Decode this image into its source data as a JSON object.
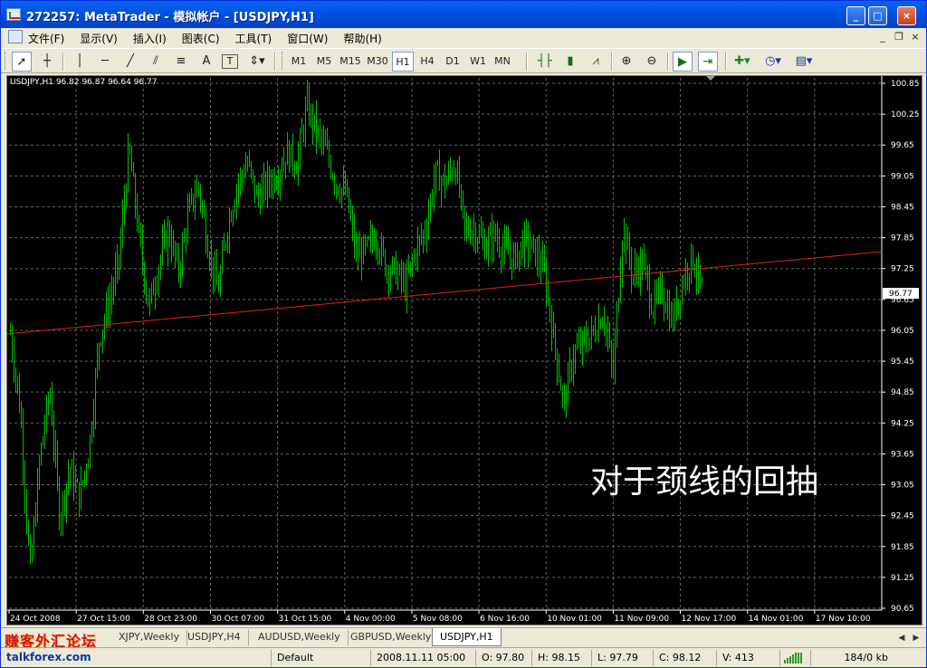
{
  "window": {
    "title": "272257: MetaTrader - 模拟帐户 - [USDJPY,H1]",
    "controls": [
      "_",
      "□",
      "×"
    ]
  },
  "menu": {
    "items": [
      "文件(F)",
      "显示(V)",
      "插入(I)",
      "图表(C)",
      "工具(T)",
      "窗口(W)",
      "帮助(H)"
    ],
    "mdi_controls": [
      "_",
      "❐",
      "×"
    ]
  },
  "toolbar": {
    "timeframes": [
      "M1",
      "M5",
      "M15",
      "M30",
      "H1",
      "H4",
      "D1",
      "W1",
      "MN"
    ],
    "active_timeframe": "H1",
    "text_tool": "A",
    "text_label_tool": "T"
  },
  "chart": {
    "symbol_info": "USDJPY,H1  96.82 96.87 96.64 96.77",
    "annotation": "对于颈线的回抽",
    "current_price_label": "96.77",
    "colors": {
      "background": "#000000",
      "bars": "#00c000",
      "grid": "#5a6a5a",
      "trendline": "#e02020",
      "text": "#ffffff"
    }
  },
  "chart_data": {
    "type": "bar",
    "title": "USDJPY,H1",
    "ylim": [
      90.65,
      100.85
    ],
    "y_ticks": [
      "100.85",
      "100.25",
      "99.65",
      "99.05",
      "98.45",
      "97.85",
      "97.25",
      "96.65",
      "96.05",
      "95.45",
      "94.85",
      "94.25",
      "93.65",
      "93.05",
      "92.45",
      "91.85",
      "91.25",
      "90.65"
    ],
    "x_ticks": [
      "24 Oct 2008",
      "27 Oct 15:00",
      "28 Oct 23:00",
      "30 Oct 07:00",
      "31 Oct 15:00",
      "4 Nov 00:00",
      "5 Nov 08:00",
      "6 Nov 16:00",
      "10 Nov 01:00",
      "11 Nov 09:00",
      "12 Nov 17:00",
      "14 Nov 01:00",
      "17 Nov 10:00"
    ],
    "price_path": [
      96.0,
      94.5,
      91.3,
      93.6,
      94.9,
      92.4,
      93.4,
      92.8,
      93.8,
      95.9,
      96.6,
      97.4,
      99.6,
      97.9,
      96.5,
      97.3,
      98.0,
      97.2,
      98.3,
      98.9,
      97.7,
      96.8,
      98.1,
      98.9,
      99.3,
      98.6,
      98.9,
      99.1,
      99.5,
      99.3,
      100.4,
      99.9,
      99.5,
      98.9,
      98.7,
      97.5,
      97.6,
      97.9,
      97.3,
      97.2,
      96.9,
      97.6,
      98.0,
      99.1,
      98.9,
      99.3,
      98.0,
      98.0,
      97.7,
      97.9,
      97.6,
      97.4,
      97.8,
      97.6,
      97.2,
      95.9,
      94.6,
      95.6,
      95.8,
      96.0,
      96.4,
      95.2,
      98.1,
      97.1,
      97.4,
      96.5,
      96.8,
      96.2,
      97.0,
      97.5,
      96.8
    ],
    "trendline": {
      "start": 95.98,
      "end": 97.58
    },
    "last_price": 96.77
  },
  "tabs": {
    "watermark": "赚客外汇论坛",
    "items": [
      "XJPY,Weekly",
      "USDJPY,H4",
      "AUDUSD,Weekly",
      "GBPUSD,Weekly",
      "USDJPY,H1"
    ],
    "active": "USDJPY,H1",
    "scroll": [
      "◀",
      "▶"
    ]
  },
  "status": {
    "watermark": "talkforex.com",
    "profile": "Default",
    "datetime": "2008.11.11 05:00",
    "open": "O: 97.80",
    "high": "H: 98.15",
    "low": "L: 97.79",
    "close": "C: 98.12",
    "volume": "V: 413",
    "traffic": "184/0 kb"
  }
}
